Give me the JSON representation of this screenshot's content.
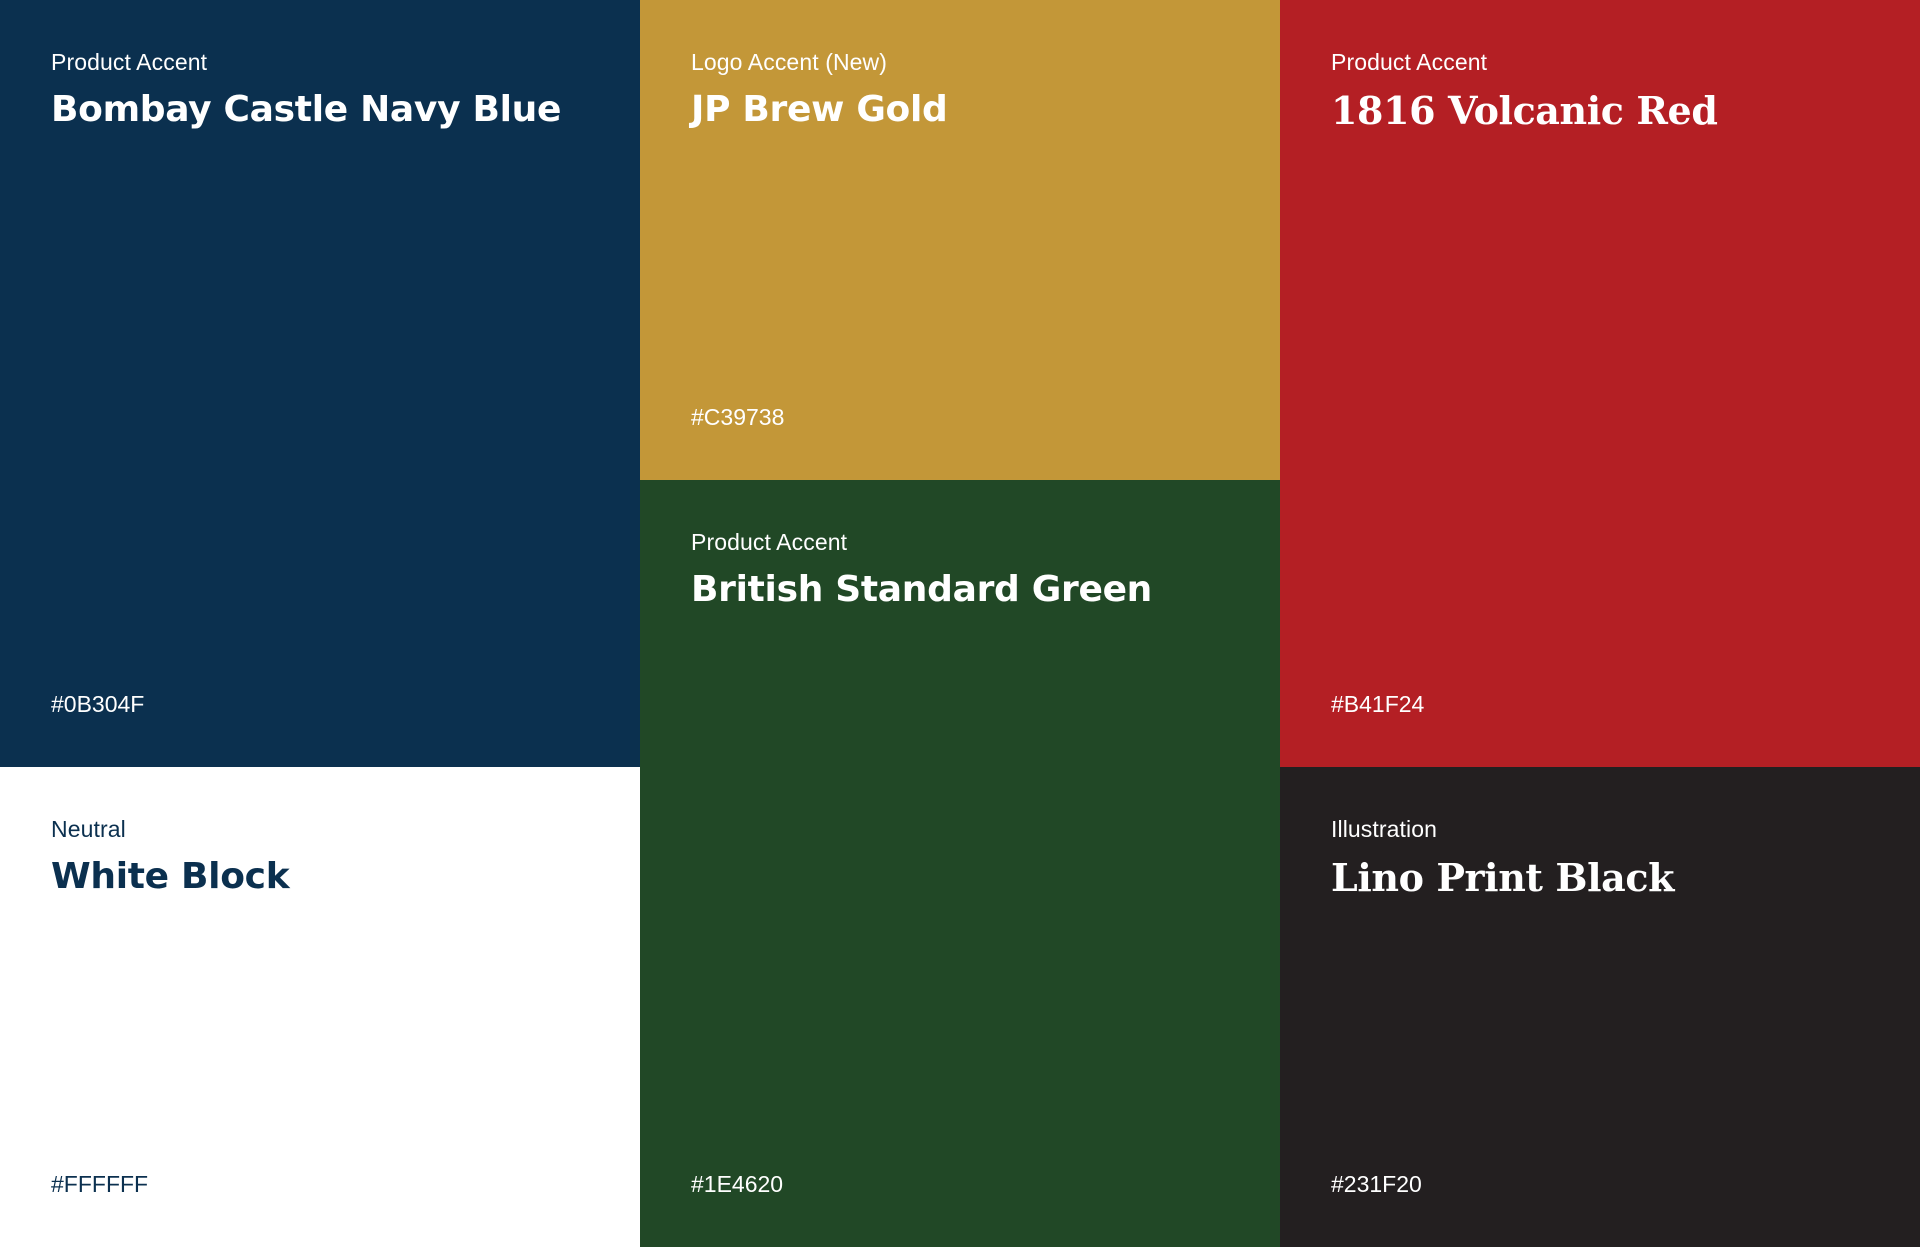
{
  "swatches": {
    "navy": {
      "category": "Product Accent",
      "name": "Bombay Castle Navy Blue",
      "hex": "#0B304F",
      "background": "#0B304F",
      "text_color": "#FFFFFF"
    },
    "gold": {
      "category": "Logo Accent (New)",
      "name": "JP Brew Gold",
      "hex": "#C39738",
      "background": "#C39738",
      "text_color": "#FFFFFF"
    },
    "red": {
      "category": "Product Accent",
      "name": "1816 Volcanic Red",
      "hex": "#B41F24",
      "background": "#B41F24",
      "text_color": "#FFFFFF"
    },
    "white": {
      "category": "Neutral",
      "name": "White Block",
      "hex": "#FFFFFF",
      "background": "#FFFFFF",
      "text_color": "#0B304F"
    },
    "green": {
      "category": "Product Accent",
      "name": "British Standard Green",
      "hex": "#1E4620",
      "background": "#214826",
      "text_color": "#FFFFFF"
    },
    "black": {
      "category": "Illustration",
      "name": "Lino Print Black",
      "hex": "#231F20",
      "background": "#231F20",
      "text_color": "#FFFFFF"
    }
  }
}
